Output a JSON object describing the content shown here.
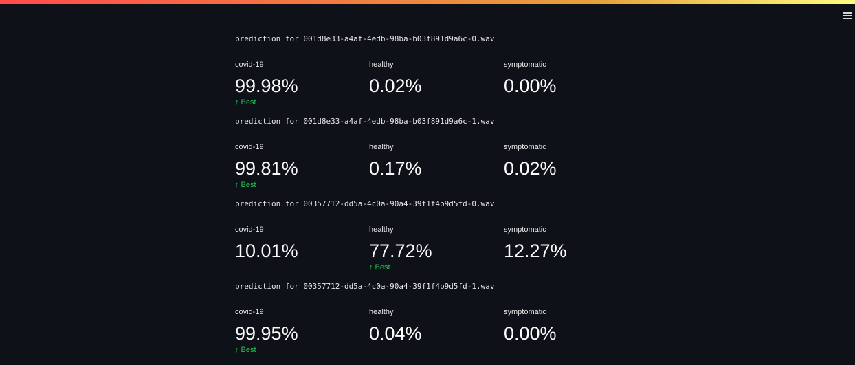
{
  "menu": {
    "icon": "hamburger-menu-icon"
  },
  "colors": {
    "delta": "#21c354",
    "background": "#0e1117",
    "text": "#fafafa"
  },
  "predictions": [
    {
      "title": "prediction for 001d8e33-a4af-4edb-98ba-b03f891d9a6c-0.wav",
      "metrics": [
        {
          "label": "covid-19",
          "value": "99.98%",
          "delta": "Best"
        },
        {
          "label": "healthy",
          "value": "0.02%",
          "delta": ""
        },
        {
          "label": "symptomatic",
          "value": "0.00%",
          "delta": ""
        }
      ]
    },
    {
      "title": "prediction for 001d8e33-a4af-4edb-98ba-b03f891d9a6c-1.wav",
      "metrics": [
        {
          "label": "covid-19",
          "value": "99.81%",
          "delta": "Best"
        },
        {
          "label": "healthy",
          "value": "0.17%",
          "delta": ""
        },
        {
          "label": "symptomatic",
          "value": "0.02%",
          "delta": ""
        }
      ]
    },
    {
      "title": "prediction for 00357712-dd5a-4c0a-90a4-39f1f4b9d5fd-0.wav",
      "metrics": [
        {
          "label": "covid-19",
          "value": "10.01%",
          "delta": ""
        },
        {
          "label": "healthy",
          "value": "77.72%",
          "delta": "Best"
        },
        {
          "label": "symptomatic",
          "value": "12.27%",
          "delta": ""
        }
      ]
    },
    {
      "title": "prediction for 00357712-dd5a-4c0a-90a4-39f1f4b9d5fd-1.wav",
      "metrics": [
        {
          "label": "covid-19",
          "value": "99.95%",
          "delta": "Best"
        },
        {
          "label": "healthy",
          "value": "0.04%",
          "delta": ""
        },
        {
          "label": "symptomatic",
          "value": "0.00%",
          "delta": ""
        }
      ]
    }
  ]
}
